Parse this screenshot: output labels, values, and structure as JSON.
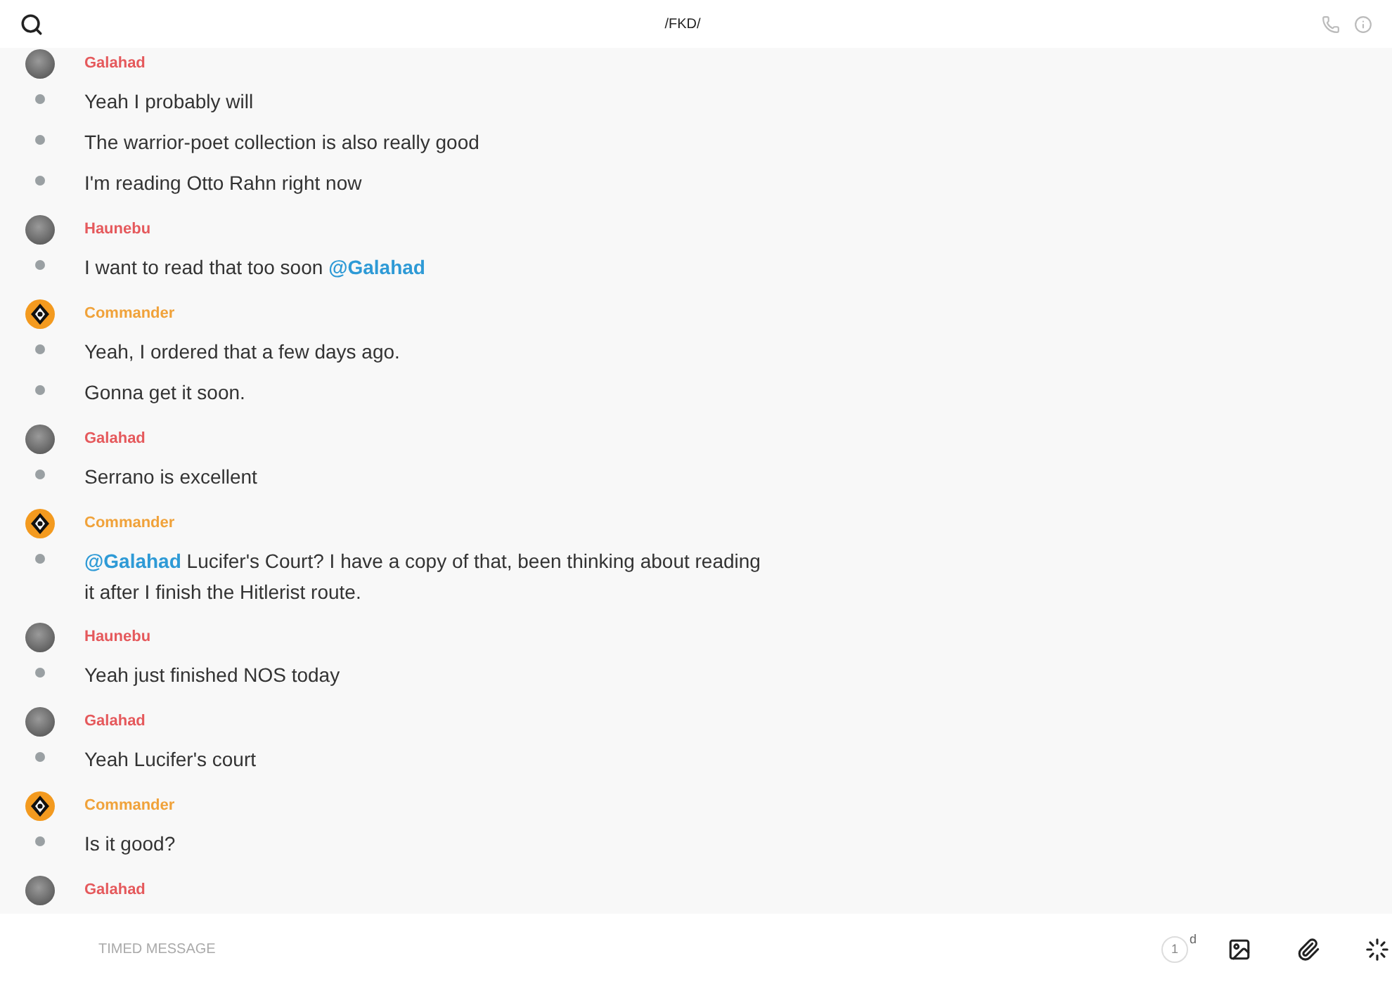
{
  "header": {
    "title": "/FKD/"
  },
  "groups": [
    {
      "sender": "Galahad",
      "color": "#e5595c",
      "kind": "photo",
      "messages": [
        [
          {
            "kind": "text",
            "text": "Yeah I probably will"
          }
        ],
        [
          {
            "kind": "text",
            "text": "The warrior-poet collection is also really good"
          }
        ],
        [
          {
            "kind": "text",
            "text": "I'm reading Otto Rahn right now"
          }
        ]
      ]
    },
    {
      "sender": "Haunebu",
      "color": "#e5595c",
      "kind": "photo",
      "messages": [
        [
          {
            "kind": "text",
            "text": "I want to read that too soon "
          },
          {
            "kind": "mention",
            "text": "@Galahad"
          }
        ]
      ]
    },
    {
      "sender": "Commander",
      "color": "#f0a23a",
      "kind": "emblem",
      "messages": [
        [
          {
            "kind": "text",
            "text": "Yeah, I ordered that a few days ago."
          }
        ],
        [
          {
            "kind": "text",
            "text": "Gonna get it soon."
          }
        ]
      ]
    },
    {
      "sender": "Galahad",
      "color": "#e5595c",
      "kind": "photo",
      "messages": [
        [
          {
            "kind": "text",
            "text": "Serrano is excellent"
          }
        ]
      ]
    },
    {
      "sender": "Commander",
      "color": "#f0a23a",
      "kind": "emblem",
      "messages": [
        [
          {
            "kind": "mention",
            "text": "@Galahad"
          },
          {
            "kind": "text",
            "text": " Lucifer's Court? I have a copy of that, been thinking about reading it after I finish the Hitlerist route."
          }
        ]
      ]
    },
    {
      "sender": "Haunebu",
      "color": "#e5595c",
      "kind": "photo",
      "messages": [
        [
          {
            "kind": "text",
            "text": "Yeah just finished NOS today"
          }
        ]
      ]
    },
    {
      "sender": "Galahad",
      "color": "#e5595c",
      "kind": "photo",
      "messages": [
        [
          {
            "kind": "text",
            "text": "Yeah Lucifer's court"
          }
        ]
      ]
    },
    {
      "sender": "Commander",
      "color": "#f0a23a",
      "kind": "emblem",
      "messages": [
        [
          {
            "kind": "text",
            "text": "Is it good?"
          }
        ]
      ]
    },
    {
      "sender": "Galahad",
      "color": "#e5595c",
      "kind": "photo"
    }
  ],
  "composer": {
    "placeholder": "TIMED MESSAGE",
    "timer_value": "1",
    "timer_unit": "d"
  }
}
